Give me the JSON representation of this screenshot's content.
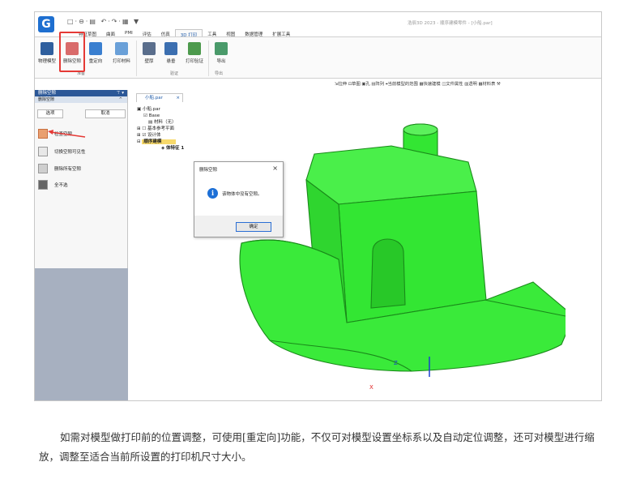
{
  "app": {
    "logo": "G",
    "quick_access": "□·⊖·▤ ↶·↷·▦ ▼",
    "window_title": "浩辰3D 2023 - 顺序建模零件 - [小船.par]"
  },
  "tabs": [
    "特征草图",
    "曲面",
    "PMI",
    "评估",
    "仿真",
    "3D 打印",
    "工具",
    "视图",
    "数据管理",
    "扩展工具"
  ],
  "active_tab": "3D 打印",
  "ribbon": {
    "buttons": [
      "物理模型",
      "删除空隙",
      "重定向",
      "打印材料",
      "壁厚",
      "悬垂",
      "打印验证",
      "导出"
    ],
    "groups": [
      "准备",
      "验证",
      "导出"
    ]
  },
  "toolbar_strip": "⇲拉伸 ⊡草图 ▣孔 ▤阵列 ⌖当前模型的范围 ▦快速建模 ◫文件属性 ▥透明 ▦材料表 ⚒",
  "left_panel": {
    "title": "删除空隙",
    "title_icons": "⊤ ▾",
    "section": "删除空隙",
    "section_toggle": "^",
    "options_button": "选项",
    "cancel_button": "取消",
    "items": [
      "检查空隙",
      "切换空隙可见性",
      "删除所有空隙",
      "全不选"
    ]
  },
  "doc_tab": {
    "label": "小船.par",
    "close": "×"
  },
  "tree": [
    "小船.par",
    "Base",
    "材料（无）",
    "基本参考平面",
    "设计体",
    "顺序建模",
    "体特征 1"
  ],
  "dialog": {
    "title": "删除空隙",
    "close": "×",
    "message": "该物体中没有空隙。",
    "ok_button": "确定"
  },
  "axes": {
    "z": "Z",
    "x": "X"
  },
  "caption": "如需对模型做打印前的位置调整，可使用[重定向]功能，不仅可对模型设置坐标系以及自动定位调整，还可对模型进行缩放，调整至适合当前所设置的打印机尺寸大小。",
  "colors": {
    "model": "#33e633",
    "model_edge": "#1a8a1a",
    "accent": "#2b5797",
    "highlight": "#e53935",
    "info": "#1c6fd6"
  }
}
